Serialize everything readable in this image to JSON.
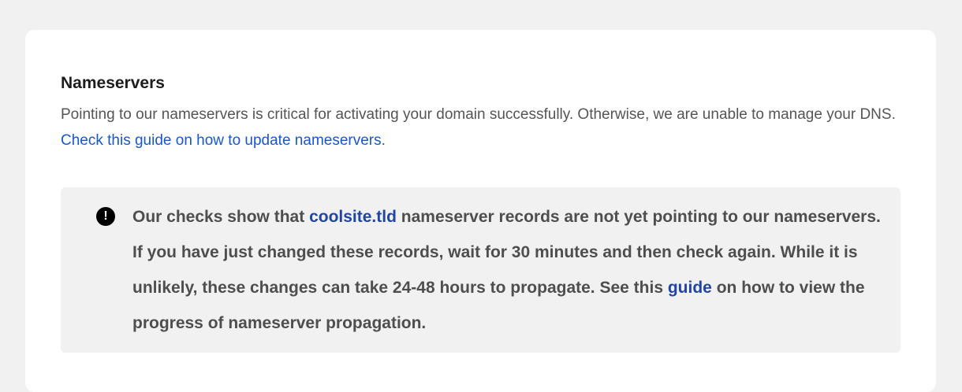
{
  "nameservers": {
    "title": "Nameservers",
    "description_part1": "Pointing to our nameservers is critical for activating your domain successfully. Otherwise, we are unable to manage your DNS.",
    "guide_link": "Check this guide on how to update nameservers",
    "description_end": "."
  },
  "notice": {
    "icon": "exclamation-circle-icon",
    "text_part1": "Our checks show that",
    "domain": "coolsite.tld",
    "text_part2": "nameserver records are not yet pointing to our nameservers. If you have just changed these records, wait for 30 minutes and then check again. While it is unlikely, these changes can take 24-48 hours to propagate. See this",
    "guide_link": "guide",
    "text_part3": "on how to view the progress of nameserver propagation."
  },
  "colors": {
    "background": "#f1f1f1",
    "card": "#ffffff",
    "link": "#1658d0",
    "notice_link": "#2145a3",
    "text": "#555555"
  }
}
